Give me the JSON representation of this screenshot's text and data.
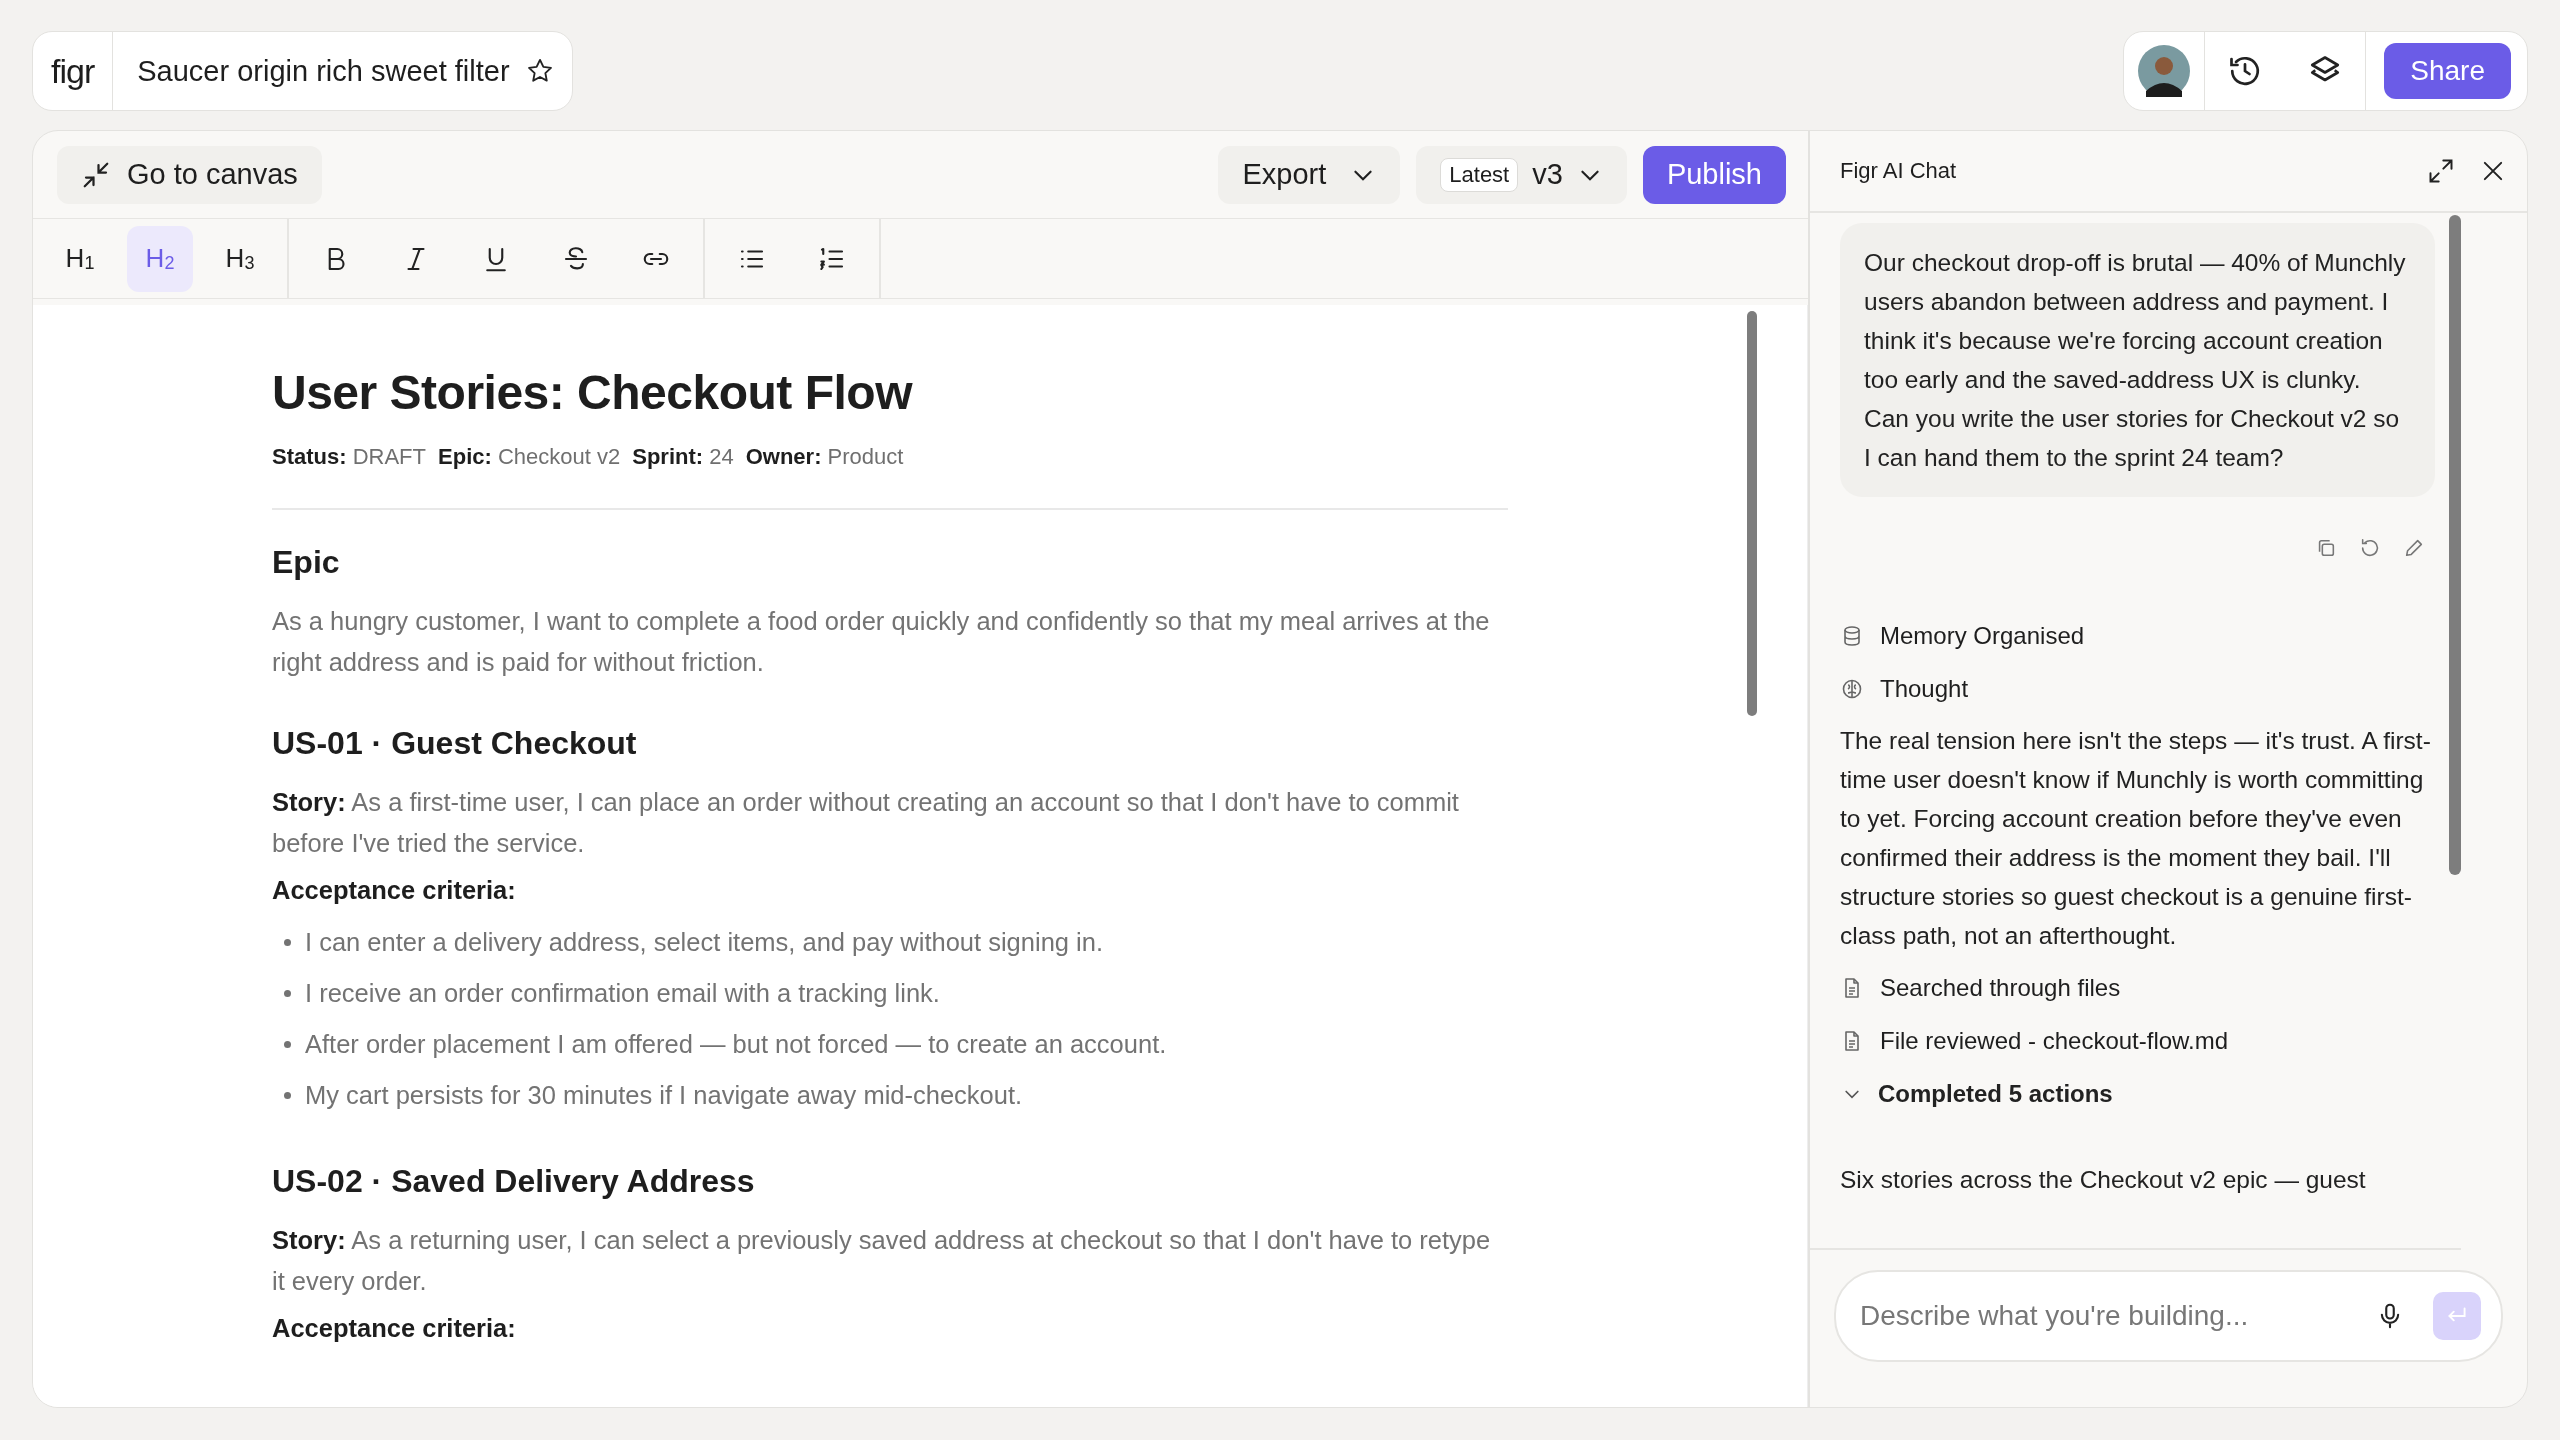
{
  "file": {
    "logo": "figr",
    "name": "Saucer origin rich sweet filter",
    "starred": false
  },
  "top_actions": {
    "share": "Share"
  },
  "editor": {
    "back": "Go to canvas",
    "export": "Export",
    "version_tag": "Latest",
    "version": "v3",
    "publish": "Publish",
    "tool_groups": [
      [
        {
          "kind": "h1",
          "label": "H$_{1}$",
          "selected": false
        },
        {
          "kind": "h2",
          "label": "H$_{2}$",
          "selected": true
        },
        {
          "kind": "h3",
          "label": "H$_{3}$",
          "selected": false
        }
      ],
      [
        {
          "kind": "bold",
          "selected": false
        },
        {
          "kind": "italic",
          "selected": false
        },
        {
          "kind": "underline",
          "selected": false
        },
        {
          "kind": "strike",
          "selected": false
        },
        {
          "kind": "link",
          "selected": false
        }
      ],
      [
        {
          "kind": "bullets",
          "selected": false
        },
        {
          "kind": "numbers",
          "selected": false
        }
      ]
    ]
  },
  "document": {
    "title": "User Stories: Checkout Flow",
    "meta": [
      {
        "label": "Status:",
        "value": "DRAFT"
      },
      {
        "label": "Epic:",
        "value": "Checkout v2"
      },
      {
        "label": "Sprint:",
        "value": "24"
      },
      {
        "label": "Owner:",
        "value": "Product"
      }
    ],
    "blocks": [
      {
        "kind": "heading",
        "text": "Epic"
      },
      {
        "kind": "paragraph",
        "text": "As a hungry customer, I want to complete a food order quickly and confidently so that my meal arrives at the right address and is paid for without friction."
      },
      {
        "kind": "heading",
        "text": "US-01 · Guest Checkout"
      },
      {
        "kind": "paragraph",
        "text": "**Story:** As a first-time user, I can place an order without creating an account so that I don't have to commit before I've tried the service."
      },
      {
        "kind": "label",
        "text": "Acceptance criteria:"
      },
      {
        "kind": "bullets",
        "items": [
          "I can enter a delivery address, select items, and pay without signing in.",
          "I receive an order confirmation email with a tracking link.",
          "After order placement I am offered — but not forced — to create an account.",
          "My cart persists for 30 minutes if I navigate away mid-checkout."
        ]
      },
      {
        "kind": "heading",
        "text": "US-02 · Saved Delivery Address"
      },
      {
        "kind": "paragraph",
        "text": "**Story:** As a returning user, I can select a previously saved address at checkout so that I don't have to retype it every order."
      },
      {
        "kind": "label",
        "text": "Acceptance criteria:"
      }
    ]
  },
  "chat": {
    "title": "Figr AI Chat",
    "user_message": "Our checkout drop-off is brutal — 40% of Munchly users abandon between address and payment. I think it's because we're forcing account creation too early and the saved-address UX is clunky. Can you write the user stories for Checkout v2 so I can hand them to the sprint 24 team?",
    "items": [
      {
        "kind": "memory",
        "text": "Memory Organised"
      },
      {
        "kind": "thought",
        "text": "Thought"
      },
      {
        "kind": "paragraph",
        "text": "The real tension here isn't the steps — it's trust. A first-time user doesn't know if Munchly is worth committing to yet. Forcing account creation before they've even confirmed their address is the moment they bail. I'll structure stories so guest checkout is a genuine first-class path, not an afterthought."
      },
      {
        "kind": "file",
        "text": "Searched through files"
      },
      {
        "kind": "file",
        "text": "File reviewed - checkout-flow.md"
      },
      {
        "kind": "toggle",
        "text": "Completed 5 actions"
      },
      {
        "kind": "reply",
        "text": "Six stories across the Checkout v2 epic — guest"
      }
    ],
    "placeholder": "Describe what you're building..."
  }
}
